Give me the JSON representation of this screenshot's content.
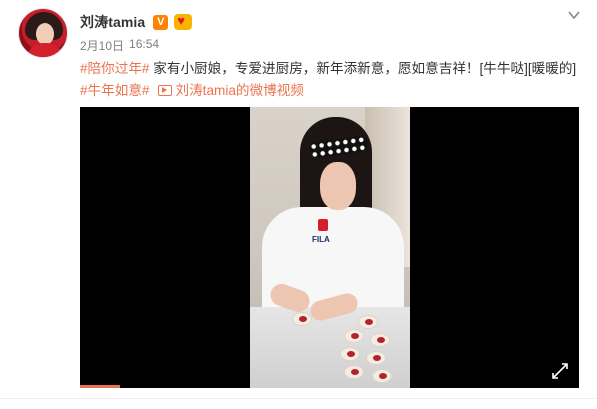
{
  "post": {
    "username": "刘涛tamia",
    "verified_badge": "V",
    "time": "2月10日",
    "clock": "16:54",
    "text": {
      "topic1": "#陪你过年#",
      "body": " 家有小厨娘，专爱进厨房，新年添新意，愿如意吉祥！[牛牛哒][暖暖的]",
      "topic2": "#牛年如意#",
      "video_link": "刘涛tamia的微博视频"
    }
  },
  "video": {
    "progress_fraction": 0.08
  },
  "colors": {
    "accent": "#eb7350",
    "verified": "#ff8200",
    "text": "#333333",
    "muted": "#808080"
  },
  "icons": [
    "chevron-down-icon",
    "video-play-icon",
    "fullscreen-icon"
  ]
}
